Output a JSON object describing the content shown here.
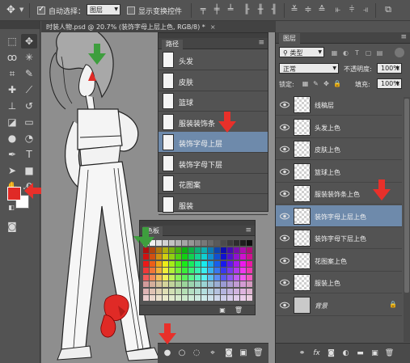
{
  "options_bar": {
    "auto_select_label": "自动选择：",
    "auto_select_checked": true,
    "auto_select_value": "图层",
    "show_transform_label": "显示变换控件",
    "show_transform_checked": false,
    "icons": [
      "move-tool-icon",
      "align-top-icon",
      "align-vcenter-icon",
      "align-bottom-icon",
      "align-left-icon",
      "align-hcenter-icon",
      "align-right-icon",
      "distribute-top-icon",
      "distribute-vcenter-icon",
      "distribute-bottom-icon",
      "distribute-left-icon",
      "distribute-hcenter-icon",
      "distribute-right-icon",
      "auto-align-icon"
    ]
  },
  "document": {
    "tab_title": "时装人物.psd @ 20.7% (装饰字母上层上色, RGB/8) *",
    "close_glyph": "×"
  },
  "toolbox": {
    "foreground_color": "#e02a26",
    "background_color": "#ffffff"
  },
  "paths_panel": {
    "tab_label": "路径",
    "items": [
      {
        "label": "头发",
        "selected": false
      },
      {
        "label": "皮肤",
        "selected": false
      },
      {
        "label": "篮球",
        "selected": false
      },
      {
        "label": "服装装饰条",
        "selected": false
      },
      {
        "label": "装饰字母上层",
        "selected": true
      },
      {
        "label": "装饰字母下层",
        "selected": false
      },
      {
        "label": "花图案",
        "selected": false
      },
      {
        "label": "服装",
        "selected": false
      }
    ]
  },
  "swatches_panel": {
    "tab_label": "色板"
  },
  "layers_panel": {
    "tab_label": "图层",
    "filter_kind": "类型",
    "blend_mode": "正常",
    "opacity_label": "不透明度:",
    "opacity_value": "100%",
    "lock_label": "锁定:",
    "fill_label": "填充:",
    "fill_value": "100%",
    "layers": [
      {
        "name": "线稿层",
        "selected": false,
        "background": false
      },
      {
        "name": "头发上色",
        "selected": false,
        "background": false
      },
      {
        "name": "皮肤上色",
        "selected": false,
        "background": false
      },
      {
        "name": "篮球上色",
        "selected": false,
        "background": false
      },
      {
        "name": "服装装饰条上色",
        "selected": false,
        "background": false
      },
      {
        "name": "装饰字母上层上色",
        "selected": true,
        "background": false
      },
      {
        "name": "装饰字母下层上色",
        "selected": false,
        "background": false
      },
      {
        "name": "花图案上色",
        "selected": false,
        "background": false
      },
      {
        "name": "服装上色",
        "selected": false,
        "background": false
      },
      {
        "name": "背景",
        "selected": false,
        "background": true
      }
    ],
    "footer_icons": [
      "link-layers-icon",
      "fx-icon",
      "add-mask-icon",
      "adjustment-layer-icon",
      "new-group-icon",
      "new-layer-icon",
      "delete-layer-icon"
    ]
  },
  "paths_footer": {
    "icons": [
      "fill-path-icon",
      "stroke-path-icon",
      "load-selection-icon",
      "make-work-path-icon",
      "add-mask-icon",
      "new-path-icon",
      "delete-path-icon"
    ]
  },
  "annotations": {
    "arrow_color": "#e8302a",
    "green_arrow_color": "#3e9e3e"
  }
}
